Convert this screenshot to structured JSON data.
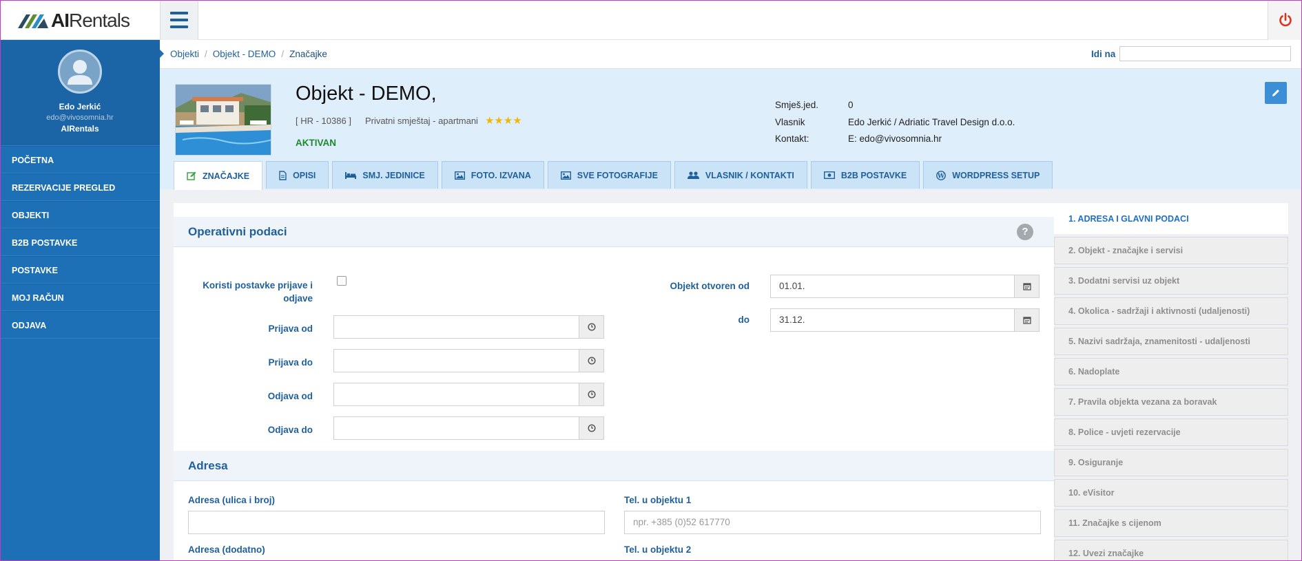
{
  "app": {
    "logo_text_bold": "AI",
    "logo_text_rest": "Rentals",
    "accent": "#1d6fb6"
  },
  "topbar": {
    "menu_icon": "hamburger-icon",
    "power_icon": "power-icon",
    "power_color": "#d9341f"
  },
  "sidebar": {
    "user_name": "Edo Jerkić",
    "user_email": "edo@vivosomnia.hr",
    "user_org": "AIRentals",
    "items": [
      {
        "label": "POČETNA"
      },
      {
        "label": "REZERVACIJE PREGLED"
      },
      {
        "label": "OBJEKTI"
      },
      {
        "label": "B2B POSTAVKE"
      },
      {
        "label": "POSTAVKE"
      },
      {
        "label": "MOJ RAČUN"
      },
      {
        "label": "ODJAVA"
      }
    ]
  },
  "breadcrumb": {
    "items": [
      "Objekti",
      "Objekt - DEMO",
      "Značajke"
    ],
    "goto_label": "Idi na",
    "goto_value": ""
  },
  "object": {
    "title": "Objekt - DEMO,",
    "code": "[ HR - 10386 ]",
    "type": "Privatni smještaj - apartmani",
    "stars": "★★★★",
    "status": "AKTIVAN",
    "info": [
      {
        "key": "Smješ.jed.",
        "value": "0"
      },
      {
        "key": "Vlasnik",
        "value": "Edo Jerkić / Adriatic Travel Design d.o.o."
      },
      {
        "key": "Kontakt:",
        "value": "E: edo@vivosomnia.hr"
      }
    ]
  },
  "tabs": [
    {
      "label": "ZNAČAJKE",
      "icon": "edit-icon",
      "active": true
    },
    {
      "label": "OPISI",
      "icon": "file-icon",
      "active": false
    },
    {
      "label": "SMJ. JEDINICE",
      "icon": "bed-icon",
      "active": false
    },
    {
      "label": "FOTO. IZVANA",
      "icon": "image-icon",
      "active": false
    },
    {
      "label": "SVE FOTOGRAFIJE",
      "icon": "image-icon",
      "active": false
    },
    {
      "label": "VLASNIK / KONTAKTI",
      "icon": "users-icon",
      "active": false
    },
    {
      "label": "B2B POSTAVKE",
      "icon": "money-icon",
      "active": false
    },
    {
      "label": "WORDPRESS SETUP",
      "icon": "wordpress-icon",
      "active": false
    }
  ],
  "operativni": {
    "title": "Operativni podaci",
    "checkin_settings_label": "Koristi postavke prijave i odjave",
    "checkin_settings_checked": false,
    "prijava_od_label": "Prijava od",
    "prijava_od_value": "",
    "prijava_do_label": "Prijava do",
    "prijava_do_value": "",
    "odjava_od_label": "Odjava od",
    "odjava_od_value": "",
    "odjava_do_label": "Odjava do",
    "odjava_do_value": "",
    "otvoren_od_label": "Objekt otvoren od",
    "otvoren_od_value": "01.01.",
    "do_label": "do",
    "do_value": "31.12."
  },
  "adresa": {
    "title": "Adresa",
    "street_label": "Adresa (ulica i broj)",
    "street_value": "",
    "tel1_label": "Tel. u objektu 1",
    "tel1_placeholder": "npr. +385 (0)52 617770",
    "addr2_label": "Adresa (dodatno)",
    "tel2_label": "Tel. u objektu 2"
  },
  "steps": [
    {
      "label": "1. ADRESA I GLAVNI PODACI",
      "active": true
    },
    {
      "label": "2. Objekt - značajke i servisi",
      "active": false
    },
    {
      "label": "3. Dodatni servisi uz objekt",
      "active": false
    },
    {
      "label": "4. Okolica - sadržaji i aktivnosti (udaljenosti)",
      "active": false
    },
    {
      "label": "5. Nazivi sadržaja, znamenitosti - udaljenosti",
      "active": false
    },
    {
      "label": "6. Nadoplate",
      "active": false
    },
    {
      "label": "7. Pravila objekta vezana za boravak",
      "active": false
    },
    {
      "label": "8. Police - uvjeti rezervacije",
      "active": false
    },
    {
      "label": "9. Osiguranje",
      "active": false
    },
    {
      "label": "10. eVisitor",
      "active": false
    },
    {
      "label": "11. Značajke s cijenom",
      "active": false
    },
    {
      "label": "12. Uvezi značajke",
      "active": false
    }
  ]
}
